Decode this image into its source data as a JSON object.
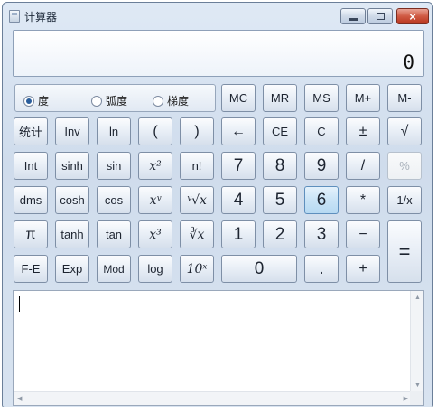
{
  "window": {
    "title": "计算器",
    "close_glyph": "×"
  },
  "display": {
    "value": "0"
  },
  "angle_mode": {
    "options": [
      "度",
      "弧度",
      "梯度"
    ],
    "selected": "度"
  },
  "memory_keys": [
    "MC",
    "MR",
    "MS",
    "M+",
    "M-"
  ],
  "rows": {
    "r2": [
      "统计",
      "Inv",
      "ln",
      "(",
      ")",
      "←",
      "CE",
      "C",
      "±",
      "√"
    ],
    "r3": [
      "Int",
      "sinh",
      "sin",
      "x²",
      "n!",
      "7",
      "8",
      "9",
      "/",
      "%"
    ],
    "r4": [
      "dms",
      "cosh",
      "cos",
      "xʸ",
      "ʸ√x",
      "4",
      "5",
      "6",
      "*",
      "1/x"
    ],
    "r5": [
      "π",
      "tanh",
      "tan",
      "x³",
      "∛x",
      "1",
      "2",
      "3",
      "−"
    ],
    "r6": [
      "F-E",
      "Exp",
      "Mod",
      "log",
      "10ˣ",
      "0",
      ".",
      "+"
    ],
    "equals": "="
  },
  "scroll_arrows": {
    "up": "▲",
    "down": "▼",
    "left": "◀",
    "right": "▶"
  }
}
